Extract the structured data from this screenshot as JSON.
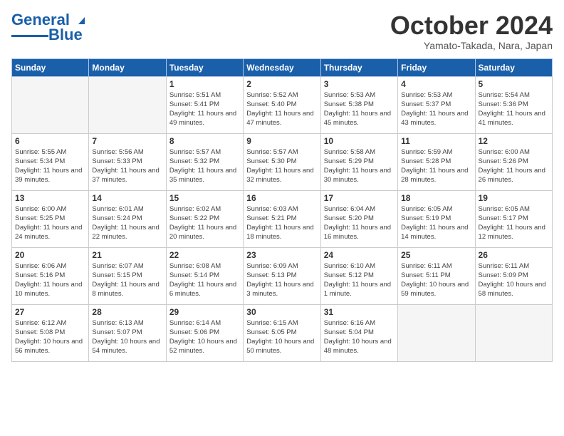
{
  "header": {
    "logo_line1": "General",
    "logo_line2": "Blue",
    "month": "October 2024",
    "location": "Yamato-Takada, Nara, Japan"
  },
  "weekdays": [
    "Sunday",
    "Monday",
    "Tuesday",
    "Wednesday",
    "Thursday",
    "Friday",
    "Saturday"
  ],
  "weeks": [
    [
      {
        "day": "",
        "info": ""
      },
      {
        "day": "",
        "info": ""
      },
      {
        "day": "1",
        "info": "Sunrise: 5:51 AM\nSunset: 5:41 PM\nDaylight: 11 hours and 49 minutes."
      },
      {
        "day": "2",
        "info": "Sunrise: 5:52 AM\nSunset: 5:40 PM\nDaylight: 11 hours and 47 minutes."
      },
      {
        "day": "3",
        "info": "Sunrise: 5:53 AM\nSunset: 5:38 PM\nDaylight: 11 hours and 45 minutes."
      },
      {
        "day": "4",
        "info": "Sunrise: 5:53 AM\nSunset: 5:37 PM\nDaylight: 11 hours and 43 minutes."
      },
      {
        "day": "5",
        "info": "Sunrise: 5:54 AM\nSunset: 5:36 PM\nDaylight: 11 hours and 41 minutes."
      }
    ],
    [
      {
        "day": "6",
        "info": "Sunrise: 5:55 AM\nSunset: 5:34 PM\nDaylight: 11 hours and 39 minutes."
      },
      {
        "day": "7",
        "info": "Sunrise: 5:56 AM\nSunset: 5:33 PM\nDaylight: 11 hours and 37 minutes."
      },
      {
        "day": "8",
        "info": "Sunrise: 5:57 AM\nSunset: 5:32 PM\nDaylight: 11 hours and 35 minutes."
      },
      {
        "day": "9",
        "info": "Sunrise: 5:57 AM\nSunset: 5:30 PM\nDaylight: 11 hours and 32 minutes."
      },
      {
        "day": "10",
        "info": "Sunrise: 5:58 AM\nSunset: 5:29 PM\nDaylight: 11 hours and 30 minutes."
      },
      {
        "day": "11",
        "info": "Sunrise: 5:59 AM\nSunset: 5:28 PM\nDaylight: 11 hours and 28 minutes."
      },
      {
        "day": "12",
        "info": "Sunrise: 6:00 AM\nSunset: 5:26 PM\nDaylight: 11 hours and 26 minutes."
      }
    ],
    [
      {
        "day": "13",
        "info": "Sunrise: 6:00 AM\nSunset: 5:25 PM\nDaylight: 11 hours and 24 minutes."
      },
      {
        "day": "14",
        "info": "Sunrise: 6:01 AM\nSunset: 5:24 PM\nDaylight: 11 hours and 22 minutes."
      },
      {
        "day": "15",
        "info": "Sunrise: 6:02 AM\nSunset: 5:22 PM\nDaylight: 11 hours and 20 minutes."
      },
      {
        "day": "16",
        "info": "Sunrise: 6:03 AM\nSunset: 5:21 PM\nDaylight: 11 hours and 18 minutes."
      },
      {
        "day": "17",
        "info": "Sunrise: 6:04 AM\nSunset: 5:20 PM\nDaylight: 11 hours and 16 minutes."
      },
      {
        "day": "18",
        "info": "Sunrise: 6:05 AM\nSunset: 5:19 PM\nDaylight: 11 hours and 14 minutes."
      },
      {
        "day": "19",
        "info": "Sunrise: 6:05 AM\nSunset: 5:17 PM\nDaylight: 11 hours and 12 minutes."
      }
    ],
    [
      {
        "day": "20",
        "info": "Sunrise: 6:06 AM\nSunset: 5:16 PM\nDaylight: 11 hours and 10 minutes."
      },
      {
        "day": "21",
        "info": "Sunrise: 6:07 AM\nSunset: 5:15 PM\nDaylight: 11 hours and 8 minutes."
      },
      {
        "day": "22",
        "info": "Sunrise: 6:08 AM\nSunset: 5:14 PM\nDaylight: 11 hours and 6 minutes."
      },
      {
        "day": "23",
        "info": "Sunrise: 6:09 AM\nSunset: 5:13 PM\nDaylight: 11 hours and 3 minutes."
      },
      {
        "day": "24",
        "info": "Sunrise: 6:10 AM\nSunset: 5:12 PM\nDaylight: 11 hours and 1 minute."
      },
      {
        "day": "25",
        "info": "Sunrise: 6:11 AM\nSunset: 5:11 PM\nDaylight: 10 hours and 59 minutes."
      },
      {
        "day": "26",
        "info": "Sunrise: 6:11 AM\nSunset: 5:09 PM\nDaylight: 10 hours and 58 minutes."
      }
    ],
    [
      {
        "day": "27",
        "info": "Sunrise: 6:12 AM\nSunset: 5:08 PM\nDaylight: 10 hours and 56 minutes."
      },
      {
        "day": "28",
        "info": "Sunrise: 6:13 AM\nSunset: 5:07 PM\nDaylight: 10 hours and 54 minutes."
      },
      {
        "day": "29",
        "info": "Sunrise: 6:14 AM\nSunset: 5:06 PM\nDaylight: 10 hours and 52 minutes."
      },
      {
        "day": "30",
        "info": "Sunrise: 6:15 AM\nSunset: 5:05 PM\nDaylight: 10 hours and 50 minutes."
      },
      {
        "day": "31",
        "info": "Sunrise: 6:16 AM\nSunset: 5:04 PM\nDaylight: 10 hours and 48 minutes."
      },
      {
        "day": "",
        "info": ""
      },
      {
        "day": "",
        "info": ""
      }
    ]
  ]
}
